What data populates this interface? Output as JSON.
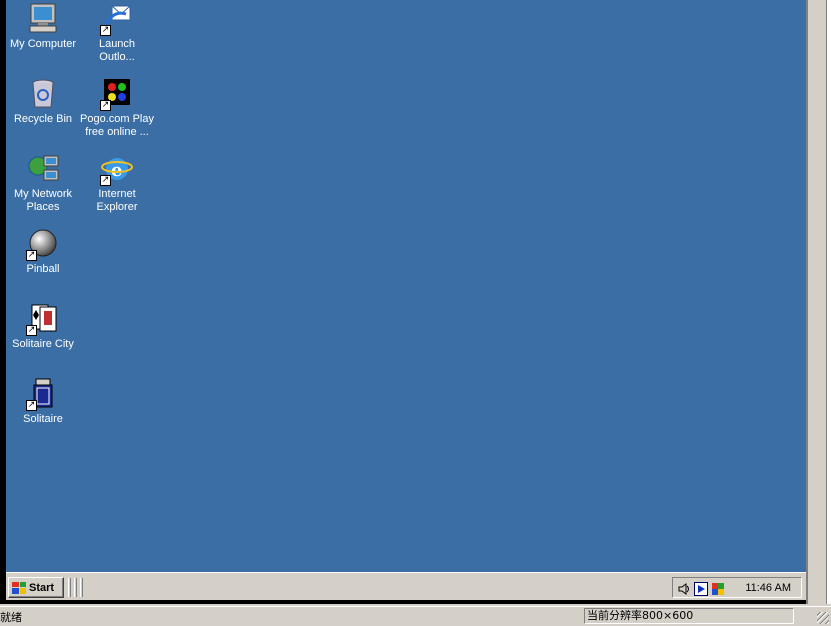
{
  "desktop": {
    "background": "#3a6ea5",
    "icons": [
      {
        "label": "My Computer",
        "icon": "computer-icon"
      },
      {
        "label": "Launch Outlo...",
        "icon": "outlook-icon"
      },
      {
        "label": "Recycle Bin",
        "icon": "recycle-bin-icon"
      },
      {
        "label": "Pogo.com Play free online ...",
        "icon": "pogo-icon"
      },
      {
        "label": "My Network Places",
        "icon": "network-icon"
      },
      {
        "label": "Internet Explorer",
        "icon": "ie-icon"
      },
      {
        "label": "Pinball",
        "icon": "pinball-icon"
      },
      {
        "label": "Solitaire City",
        "icon": "cards-icon"
      },
      {
        "label": "Solitaire",
        "icon": "solitaire-icon"
      }
    ]
  },
  "taskbar": {
    "start_label": "Start",
    "clock": "11:46 AM"
  },
  "statusbar": {
    "left_text": "就绪",
    "right_text": "当前分辨率800×600"
  }
}
